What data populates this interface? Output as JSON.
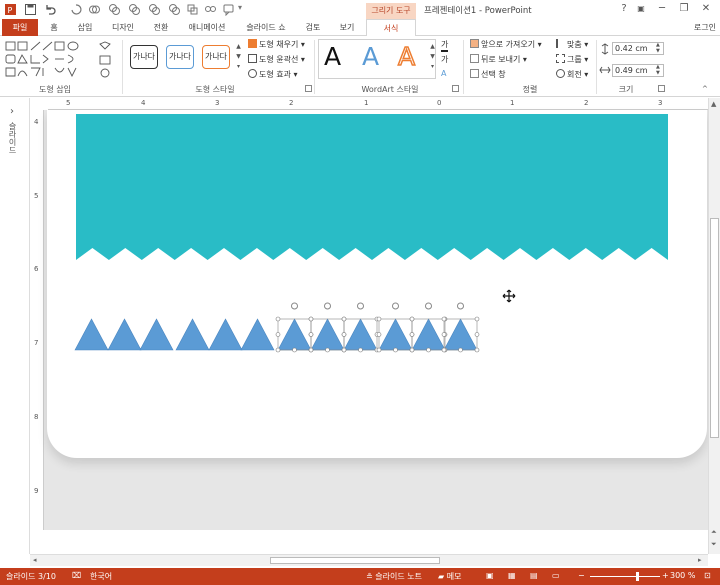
{
  "window": {
    "doc_title": "프레젠테이션1 - PowerPoint",
    "context_group": "그리기 도구",
    "help": "?",
    "minimize": "─",
    "restore": "❐",
    "close": "✕",
    "login": "로그인"
  },
  "tabs": [
    {
      "label": "파일"
    },
    {
      "label": "홈"
    },
    {
      "label": "삽입"
    },
    {
      "label": "디자인"
    },
    {
      "label": "전환"
    },
    {
      "label": "애니메이션"
    },
    {
      "label": "슬라이드 쇼"
    },
    {
      "label": "검토"
    },
    {
      "label": "보기"
    },
    {
      "label": "서식"
    }
  ],
  "ribbon": {
    "groups": {
      "insert_shapes": "도형 삽입",
      "shape_styles": "도형 스타일",
      "wordart_styles": "WordArt 스타일",
      "arrange": "정렬",
      "size": "크기"
    },
    "style_sample": "가나다",
    "shape_fill": "도형 채우기",
    "shape_outline": "도형 윤곽선",
    "shape_effects": "도형 효과",
    "wordart_letter": "A",
    "text_fill": "가",
    "text_outline": "가",
    "bring_forward": "앞으로 가져오기",
    "send_backward": "뒤로 보내기",
    "selection_pane": "선택 창",
    "align": "맞춤",
    "group": "그룹",
    "rotate": "회전",
    "height": "0.42 cm",
    "width": "0.49 cm"
  },
  "left_panel": {
    "label": "슬라이드"
  },
  "rulers": {
    "h": [
      "5",
      "4",
      "3",
      "2",
      "1",
      "0",
      "1",
      "2",
      "3"
    ],
    "v": [
      "4",
      "5",
      "6",
      "7",
      "8",
      "9"
    ]
  },
  "status": {
    "slide": "슬라이드 3/10",
    "language": "한국어",
    "notes": "슬라이드 노트",
    "comments": "메모",
    "zoom": "300 %"
  },
  "colors": {
    "accent": "#c43e1c",
    "banner": "#29bcc6",
    "triangle": "#5b9bd5"
  }
}
